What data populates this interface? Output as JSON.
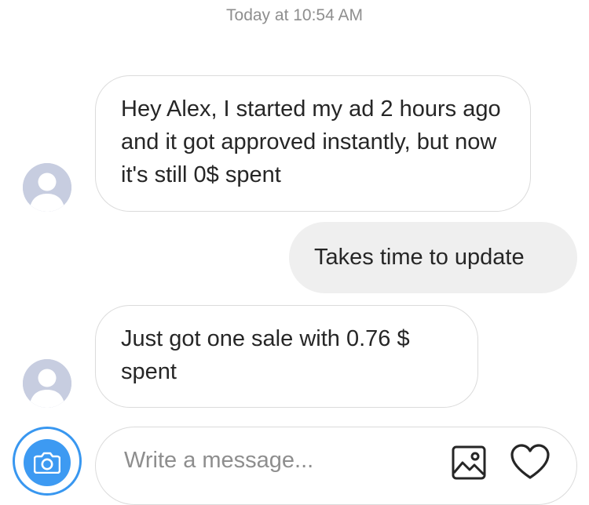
{
  "header": {
    "timestamp": "Today at 10:54 AM"
  },
  "messages": [
    {
      "direction": "incoming",
      "text": "Hey Alex, I started my ad 2 hours ago and it got approved instantly, but now it's still 0$ spent"
    },
    {
      "direction": "outgoing",
      "text": "Takes time to update"
    },
    {
      "direction": "incoming",
      "text": "Just got one sale with 0.76 $ spent"
    }
  ],
  "composer": {
    "placeholder": "Write a message...",
    "value": "",
    "camera_icon": "camera-icon",
    "gallery_icon": "gallery-icon",
    "like_icon": "heart-icon"
  },
  "colors": {
    "accent": "#3897f0",
    "incoming_border": "#dbdbdb",
    "outgoing_bg": "#efefef",
    "avatar_bg": "#c7cde0"
  }
}
